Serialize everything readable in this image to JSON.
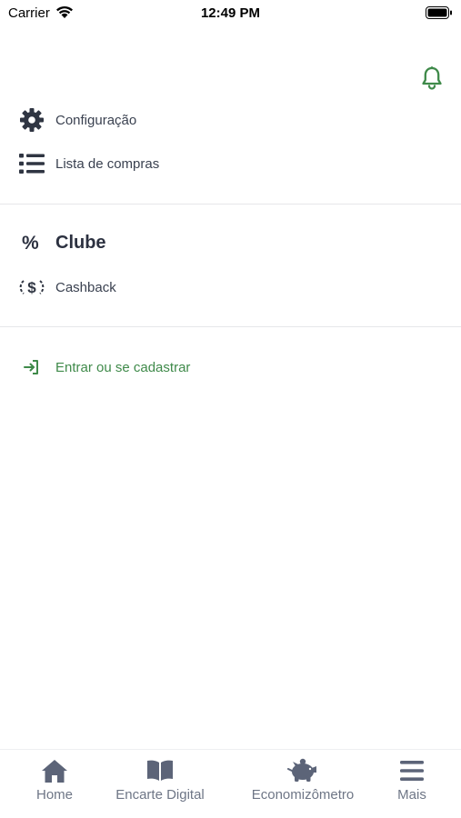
{
  "status_bar": {
    "carrier": "Carrier",
    "time": "12:49 PM"
  },
  "menu": {
    "items": [
      {
        "label": "Configuração",
        "icon": "gear-icon"
      },
      {
        "label": "Lista de compras",
        "icon": "list-icon"
      }
    ]
  },
  "clube": {
    "title": "Clube",
    "icon_symbol": "%",
    "items": [
      {
        "label": "Cashback",
        "icon": "cashback-icon"
      }
    ]
  },
  "login": {
    "label": "Entrar ou se cadastrar",
    "icon": "login-icon"
  },
  "tab_bar": {
    "tabs": [
      {
        "label": "Home",
        "icon": "home-icon"
      },
      {
        "label": "Encarte Digital",
        "icon": "book-icon"
      },
      {
        "label": "Economizômetro",
        "icon": "piggy-bank-icon"
      },
      {
        "label": "Mais",
        "icon": "menu-icon"
      }
    ]
  },
  "colors": {
    "accent_green": "#3f8a4a",
    "icon_dark": "#2f3542",
    "tab_gray": "#6e7686"
  }
}
